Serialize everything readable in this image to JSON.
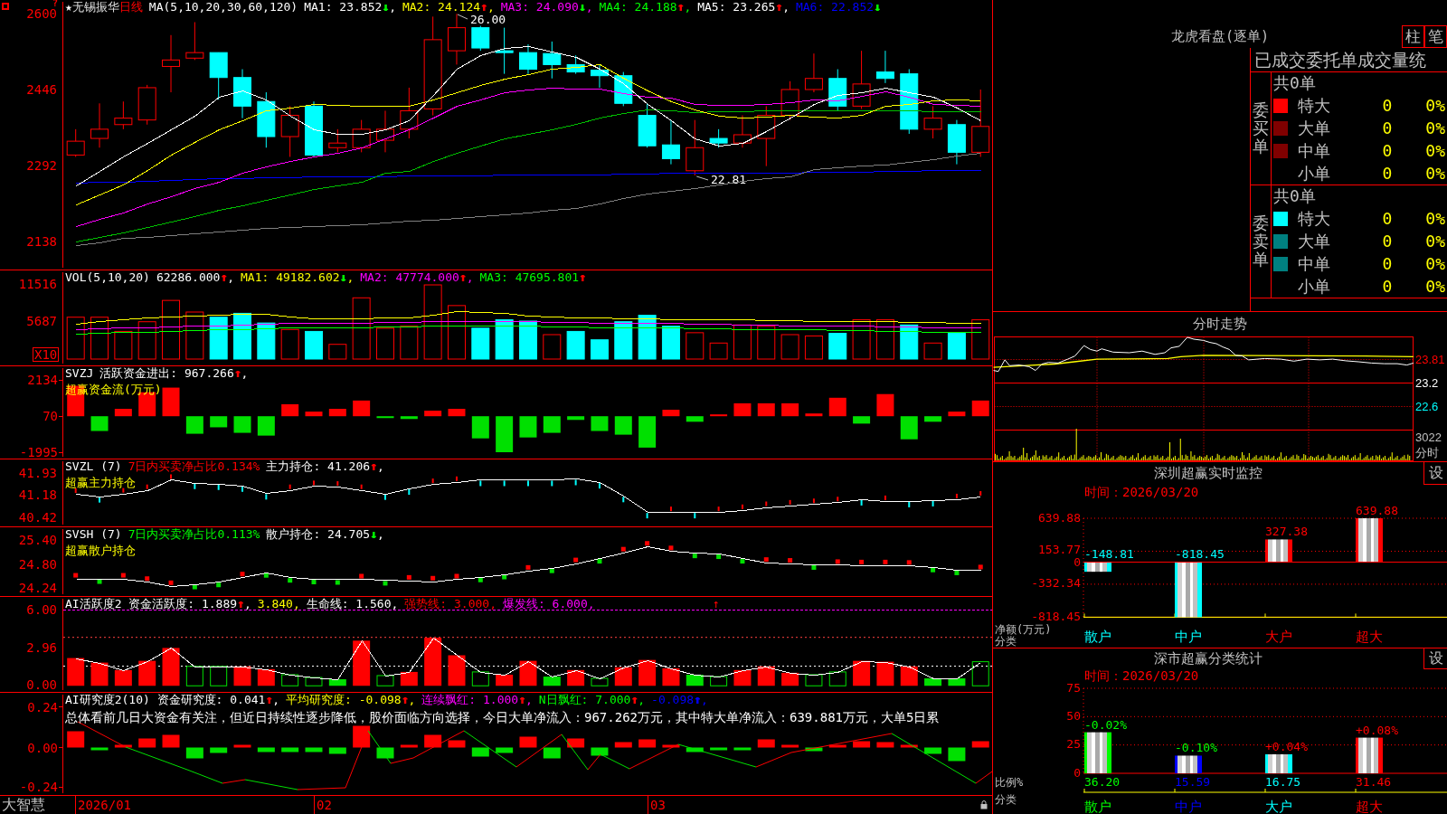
{
  "chart_header": {
    "help_mark": "?",
    "star": "★",
    "name": "无锡振华",
    "period": "日线",
    "legend": [
      {
        "text": "MA(5,10,20,30,60,120)",
        "color": "#ffffff"
      },
      {
        "text": "MA1: 23.852",
        "color": "#ffffff",
        "arrow": {
          "text": "↓",
          "color": "#00ff00"
        },
        "tail": ","
      },
      {
        "text": "MA2: 24.124",
        "color": "#ffff00",
        "arrow": {
          "text": "↑",
          "color": "#ff0000"
        },
        "tail": ","
      },
      {
        "text": "MA3: 24.090",
        "color": "#ff00ff",
        "arrow": {
          "text": "↓",
          "color": "#00ff00"
        },
        "tail": ","
      },
      {
        "text": "MA4: 24.188",
        "color": "#00ff00",
        "arrow": {
          "text": "↑",
          "color": "#ff0000"
        },
        "tail": ","
      },
      {
        "text": "MA5: 23.265",
        "color": "#ffffff",
        "arrow": {
          "text": "↑",
          "color": "#ff0000"
        },
        "tail": ","
      },
      {
        "text": "MA6: 22.852",
        "color": "#0000ff",
        "arrow": {
          "text": "↓",
          "color": "#00ff00"
        }
      }
    ]
  },
  "kline": {
    "annotations": [
      {
        "kind": "high",
        "text": "26.00"
      },
      {
        "kind": "low",
        "text": "22.81"
      }
    ],
    "chart_data": {
      "type": "line",
      "ylim": [
        2087.4,
        2626.2
      ],
      "yticks": [
        2600,
        2446,
        2292,
        2138
      ],
      "series": [
        {
          "color": "#ffffff",
          "values": [
            2254,
            2284,
            2312,
            2340,
            2368,
            2396,
            2434,
            2447,
            2428,
            2396,
            2368,
            2359,
            2359,
            2368,
            2387,
            2438,
            2490,
            2518,
            2533,
            2536,
            2525,
            2514,
            2490,
            2462,
            2420,
            2387,
            2349,
            2334,
            2340,
            2364,
            2392,
            2420,
            2437,
            2443,
            2452,
            2443,
            2434,
            2412,
            2387
          ]
        },
        {
          "color": "#ffff00",
          "values": [
            2215,
            2235,
            2256,
            2286,
            2316,
            2342,
            2368,
            2387,
            2406,
            2412,
            2419,
            2417,
            2415,
            2415,
            2415,
            2429,
            2443,
            2457,
            2471,
            2480,
            2490,
            2494,
            2499,
            2473,
            2447,
            2424,
            2409,
            2396,
            2391,
            2393,
            2398,
            2393,
            2391,
            2398,
            2415,
            2420,
            2427,
            2428,
            2426
          ]
        },
        {
          "color": "#ff00ff",
          "values": [
            2172,
            2186,
            2200,
            2217,
            2233,
            2249,
            2262,
            2279,
            2293,
            2303,
            2312,
            2321,
            2331,
            2349,
            2368,
            2392,
            2415,
            2429,
            2443,
            2448,
            2452,
            2451,
            2450,
            2442,
            2434,
            2432,
            2420,
            2418,
            2417,
            2419,
            2422,
            2428,
            2426,
            2436,
            2444,
            2433,
            2419,
            2418,
            2415
          ]
        },
        {
          "color": "#00c000",
          "values": [
            2140,
            2149,
            2159,
            2170,
            2181,
            2192,
            2204,
            2214,
            2224,
            2235,
            2247,
            2254,
            2262,
            2279,
            2284,
            2303,
            2321,
            2335,
            2349,
            2359,
            2368,
            2379,
            2391,
            2400,
            2409,
            2406,
            2403,
            2404,
            2405,
            2406,
            2406,
            2406,
            2406,
            2406,
            2406,
            2406,
            2405,
            2405,
            2404
          ]
        },
        {
          "color": "#808080",
          "values": [
            2134,
            2139,
            2147,
            2150,
            2153,
            2157,
            2161,
            2164,
            2168,
            2170,
            2172,
            2174,
            2176,
            2179,
            2182,
            2185,
            2189,
            2192,
            2196,
            2200,
            2205,
            2209,
            2218,
            2228,
            2237,
            2243,
            2249,
            2256,
            2263,
            2268,
            2273,
            2288,
            2291,
            2294,
            2297,
            2302,
            2308,
            2315,
            2321
          ]
        },
        {
          "color": "#0000ff",
          "values": [
            2260,
            2261,
            2262,
            2264,
            2265,
            2267,
            2268,
            2269,
            2271,
            2271,
            2272,
            2272,
            2273,
            2273,
            2274,
            2274,
            2275,
            2275,
            2276,
            2276,
            2276,
            2277,
            2277,
            2278,
            2278,
            2279,
            2279,
            2279,
            2280,
            2280,
            2280,
            2281,
            2282,
            2282,
            2283,
            2284,
            2285,
            2285,
            2286
          ]
        }
      ]
    }
  },
  "panels": [
    {
      "kind": "volume",
      "unit": "X10",
      "legend": [
        {
          "text": "VOL(5,10,20)",
          "color": "#ffffff"
        },
        {
          "text": "62286.000",
          "color": "#ffffff",
          "arrow": {
            "text": "↑",
            "color": "#ff0000"
          },
          "tail": ","
        },
        {
          "text": "MA1: 49182.602",
          "color": "#ffff00",
          "arrow": {
            "text": "↓",
            "color": "#00ff00"
          },
          "tail": ","
        },
        {
          "text": "MA2: 47774.000",
          "color": "#ff00ff",
          "arrow": {
            "text": "↑",
            "color": "#ff0000"
          },
          "tail": ","
        },
        {
          "text": "MA3: 47695.801",
          "color": "#00ff00",
          "arrow": {
            "text": "↑",
            "color": "#ff0000"
          }
        }
      ],
      "chart_data": {
        "type": "line",
        "ylim": [
          -871,
          13559
        ],
        "yticks": [
          11516,
          5687
        ],
        "series": [
          {
            "color": "#ffff00",
            "values": [
              5400,
              5800,
              6200,
              6400,
              6600,
              6700,
              6900,
              7000,
              7000,
              6500,
              6300,
              6300,
              6300,
              6400,
              6400,
              6900,
              7400,
              7300,
              7100,
              6700,
              6500,
              6400,
              6400,
              6300,
              6300,
              6200,
              6200,
              6100,
              6100,
              6000,
              6000,
              5900,
              5900,
              5800,
              5800,
              5700,
              5700,
              5600,
              5600
            ]
          },
          {
            "color": "#ff00ff",
            "values": [
              4600,
              4700,
              4800,
              4900,
              5000,
              5100,
              5200,
              5300,
              5400,
              5500,
              5500,
              5600,
              5600,
              5700,
              5700,
              5800,
              5800,
              5800,
              5800,
              5800,
              5700,
              5700,
              5600,
              5600,
              5500,
              5500,
              5400,
              5400,
              5300,
              5300,
              5200,
              5200,
              5100,
              5100,
              5000,
              5000,
              4900,
              4900,
              4800
            ]
          },
          {
            "color": "#00ff00",
            "values": [
              3900,
              4000,
              4100,
              4200,
              4300,
              4400,
              4500,
              4600,
              4700,
              4800,
              4800,
              4900,
              4900,
              5000,
              5000,
              5100,
              5100,
              5100,
              5100,
              5100,
              5000,
              5000,
              4900,
              4900,
              4800,
              4800,
              4700,
              4700,
              4600,
              4600,
              4500,
              4500,
              4400,
              4400,
              4300,
              4300,
              4200,
              4200,
              4100
            ]
          }
        ]
      }
    },
    {
      "kind": "flow",
      "axis": [
        "2134",
        "70",
        "-1995"
      ],
      "legend": [
        {
          "text": "SVZJ",
          "color": "#ffffff"
        },
        {
          "text": "活跃资金进出: 967.266",
          "color": "#ffffff",
          "arrow": {
            "text": "↑",
            "color": "#ff0000"
          },
          "tail": ","
        }
      ],
      "subtitle": "超赢资金流(万元)"
    },
    {
      "kind": "main_position",
      "legend": [
        {
          "text": "SVZL (7)",
          "color": "#ffffff"
        },
        {
          "text": "7日内买卖净占比0.134%",
          "color": "#ff0000"
        },
        {
          "text": "主力持仓: 41.206",
          "color": "#ffffff",
          "arrow": {
            "text": "↑",
            "color": "#ff0000"
          },
          "tail": ","
        }
      ],
      "subtitle": "超赢主力持仓",
      "chart_data": {
        "type": "line",
        "ylim": [
          40.22,
          42.34
        ],
        "yticks": [
          41.93,
          41.18,
          40.42
        ],
        "series": [
          {
            "color": "#ffffff",
            "values": [
              41.25,
              41.17,
              41.26,
              41.38,
              41.72,
              41.62,
              41.59,
              41.53,
              41.27,
              41.38,
              41.51,
              41.49,
              41.38,
              41.26,
              41.43,
              41.58,
              41.65,
              41.72,
              41.72,
              41.72,
              41.72,
              41.75,
              41.64,
              41.18,
              40.64,
              40.64,
              40.64,
              40.64,
              40.71,
              40.81,
              40.86,
              40.91,
              40.97,
              41.07,
              41.01,
              41.01,
              41.04,
              41.07,
              41.16
            ]
          }
        ]
      }
    },
    {
      "kind": "retail_position",
      "legend": [
        {
          "text": "SVSH (7)",
          "color": "#ffffff"
        },
        {
          "text": "7日内买卖净占比0.113%",
          "color": "#00ff00"
        },
        {
          "text": "散户持仓: 24.705",
          "color": "#ffffff",
          "arrow": {
            "text": "↓",
            "color": "#00ff00"
          },
          "tail": ","
        }
      ],
      "subtitle": "超赢散户持仓",
      "chart_data": {
        "type": "line",
        "ylim": [
          24.11,
          25.68
        ],
        "yticks": [
          {
            "value": 25.4,
            "label": "25.40"
          },
          {
            "value": 24.8,
            "label": "24.80"
          },
          {
            "value": 24.24,
            "label": "24.24"
          }
        ],
        "series": [
          {
            "color": "#ffffff",
            "values": [
              24.49,
              24.49,
              24.49,
              24.41,
              24.31,
              24.36,
              24.41,
              24.52,
              24.64,
              24.52,
              24.48,
              24.47,
              24.47,
              24.45,
              24.44,
              24.42,
              24.47,
              24.53,
              24.6,
              24.68,
              24.75,
              24.86,
              24.98,
              25.12,
              25.26,
              25.15,
              25.11,
              25.09,
              24.98,
              24.87,
              24.85,
              24.83,
              24.82,
              24.81,
              24.81,
              24.8,
              24.77,
              24.7,
              24.69
            ]
          }
        ]
      }
    },
    {
      "kind": "activity",
      "legend": [
        {
          "text": "AI活跃度2 资金活跃度: 1.889",
          "color": "#ffffff",
          "arrow": {
            "text": "↑",
            "color": "#ff0000"
          },
          "tail": ","
        },
        {
          "text": "3.840,",
          "color": "#ffff00"
        },
        {
          "text": "生命线: 1.560,",
          "color": "#ffffff"
        },
        {
          "text": "强势线: 3.000,",
          "color": "#ff0000"
        },
        {
          "text": "爆发线: 6.000,",
          "color": "#ff00ff"
        }
      ],
      "signal": "↑",
      "chart_data": {
        "type": "line",
        "ylim": [
          -0.34,
          6.9
        ],
        "yticks": [
          {
            "value": 6,
            "label": "6.00"
          },
          {
            "value": 2.96,
            "label": "2.96"
          },
          {
            "value": 0,
            "label": "0.00"
          }
        ],
        "series": [
          {
            "color": "#ffffff",
            "values": [
              2.2,
              1.84,
              1.25,
              1.98,
              3,
              1.54,
              1.54,
              1.54,
              1.32,
              0.88,
              0.66,
              0.52,
              3.58,
              0.81,
              1.1,
              3.81,
              2.42,
              1.1,
              0.88,
              1.98,
              0.73,
              1.25,
              0.59,
              1.47,
              2.05,
              1.39,
              0.88,
              0.73,
              1.25,
              1.54,
              1.03,
              0.88,
              1.1,
              1.98,
              1.91,
              1.54,
              0.59,
              0.59,
              1.91
            ]
          }
        ]
      }
    },
    {
      "kind": "research",
      "axis": [
        "0.24",
        "0.00",
        "-0.24"
      ],
      "legend": [
        {
          "text": "AI研究度2(10) 资金研究度: 0.041",
          "color": "#ffffff",
          "arrow": {
            "text": "↑",
            "color": "#ff0000"
          },
          "tail": ","
        },
        {
          "text": "平均研究度: -0.098",
          "color": "#ffff00",
          "arrow": {
            "text": "↑",
            "color": "#ff0000"
          },
          "tail": ","
        },
        {
          "text": "连续飘红: 1.000",
          "color": "#ff00ff",
          "arrow": {
            "text": "↑",
            "color": "#ff0000"
          },
          "tail": ","
        },
        {
          "text": "N日飘红: 7.000",
          "color": "#00ff00",
          "arrow": {
            "text": "↑",
            "color": "#ff0000"
          },
          "tail": ","
        },
        {
          "text": "-0.098",
          "color": "#0000ff",
          "arrow": {
            "text": "↑",
            "color": "#0000ff"
          },
          "tail": ","
        }
      ],
      "commentary": "总体看前几日大资金有关注，但近日持续性逐步降低，股价面临方向选择，今日大单净流入：967.262万元，其中特大单净流入：639.881万元，大单5日累"
    }
  ],
  "time_axis": {
    "brand": "大智慧",
    "dates": [
      "2026/01",
      "02",
      "03"
    ]
  },
  "dragon_panel": {
    "title": "龙虎看盘(逐单)",
    "buttons": [
      "柱",
      "笔"
    ],
    "table_title": "已成交委托单成交量统",
    "sections": [
      {
        "label": "委买单",
        "total": "共0单",
        "rows": [
          {
            "name": "特大",
            "count": "0",
            "pct": "0%",
            "color": "#ff0000"
          },
          {
            "name": "大单",
            "count": "0",
            "pct": "0%",
            "color": "#800000"
          },
          {
            "name": "中单",
            "count": "0",
            "pct": "0%",
            "color": "#800000"
          },
          {
            "name": "小单",
            "count": "0",
            "pct": "0%"
          }
        ]
      },
      {
        "label": "委卖单",
        "total": "共0单",
        "rows": [
          {
            "name": "特大",
            "count": "0",
            "pct": "0%",
            "color": "#00ffff"
          },
          {
            "name": "大单",
            "count": "0",
            "pct": "0%",
            "color": "#008080"
          },
          {
            "name": "中单",
            "count": "0",
            "pct": "0%",
            "color": "#008080"
          },
          {
            "name": "小单",
            "count": "0",
            "pct": "0%"
          }
        ]
      }
    ]
  },
  "intraday": {
    "title": "分时走势",
    "price_labels": [
      {
        "text": "23.81",
        "color": "#ff0000"
      },
      {
        "text": "23.2",
        "color": "#ffffff"
      },
      {
        "text": "22.6",
        "color": "#00ffff"
      }
    ],
    "volume_label": "3022",
    "period_label": "分时"
  },
  "sz_monitor": {
    "title": "深圳超赢实时监控",
    "settings_button": "设",
    "time": "时间：2026/03/20",
    "chart_data": {
      "type": "bar",
      "xlabel": "分类",
      "ylabel": "净额(万元)",
      "categories": [
        "散户",
        "中户",
        "大户",
        "超大"
      ],
      "values": [
        -148.81,
        -818.45,
        327.38,
        639.88
      ],
      "ylim": [
        -818.45,
        639.88
      ],
      "yticks": [
        {
          "value": 639.88,
          "label": "639.88"
        },
        {
          "value": 153.77,
          "label": "153.77"
        },
        {
          "value": 0,
          "label": "0"
        },
        {
          "value": -332.34,
          "label": "-332.34"
        },
        {
          "value": -818.45,
          "label": "-818.45"
        }
      ],
      "grid": true,
      "value_labels": [
        "-148.81",
        "-818.45",
        "327.38",
        "639.88"
      ]
    }
  },
  "sz_stats": {
    "title": "深市超赢分类统计",
    "settings_button": "设",
    "time": "时间：2026/03/20",
    "changes": [
      {
        "text": "-0.02%",
        "color": "#00ff00"
      },
      {
        "text": "-0.10%",
        "color": "#00ff00"
      },
      {
        "text": "+0.04%",
        "color": "#ff0000"
      },
      {
        "text": "+0.08%",
        "color": "#ff0000"
      }
    ],
    "chart_data": {
      "type": "bar",
      "xlabel": "分类",
      "ylabel": "比例%",
      "categories": [
        "散户",
        "中户",
        "大户",
        "超大"
      ],
      "colors": [
        "#00ff00",
        "#0000ff",
        "#00ffff",
        "#ff0000"
      ],
      "values": [
        36.2,
        15.59,
        16.75,
        31.46
      ],
      "ylim": [
        0,
        75
      ],
      "yticks": [
        0,
        25,
        50,
        75
      ],
      "grid": true,
      "value_labels": [
        "36.20",
        "15.59",
        "16.75",
        "31.46"
      ]
    }
  }
}
